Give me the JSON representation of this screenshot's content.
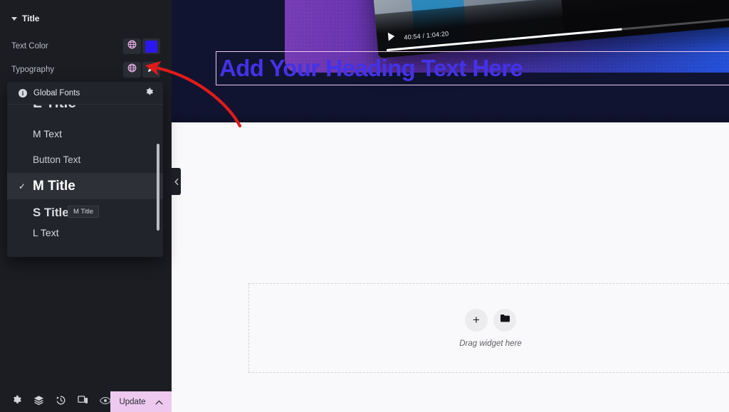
{
  "panel": {
    "section_title": "Title",
    "caret_icon": "caret-down-icon",
    "controls": [
      {
        "label": "Text Color",
        "globe_icon": "globe-icon",
        "swatch_color": "#2b18f0"
      },
      {
        "label": "Typography",
        "globe_icon": "globe-icon",
        "edit_icon": "pencil-icon"
      }
    ]
  },
  "global_fonts": {
    "header_title": "Global Fonts",
    "info_icon": "info-icon",
    "info_glyph": "i",
    "settings_icon": "gear-icon",
    "check_glyph": "✓",
    "items": [
      {
        "label": "L Title",
        "selected": false,
        "state": "clipped-top"
      },
      {
        "label": "M Text",
        "selected": false,
        "state": "full"
      },
      {
        "label": "Button Text",
        "selected": false,
        "state": "full"
      },
      {
        "label": "M Title",
        "selected": true,
        "state": "full"
      },
      {
        "label": "S Title",
        "selected": false,
        "state": "full"
      },
      {
        "label": "L Text",
        "selected": false,
        "state": "clipped-bottom"
      }
    ],
    "tooltip": "M Title"
  },
  "canvas": {
    "heading": "Add Your Heading Text Here",
    "heading_color": "#4432e8",
    "heading_outline_color": "#f0c9ee",
    "dropzone": {
      "label": "Drag widget here",
      "add_icon": "plus-icon",
      "add_glyph": "+",
      "folder_icon": "folder-icon"
    },
    "hero": {
      "video_time": "40:54 / 1:04:20",
      "play_icon": "play-icon",
      "gradient_start": "#7b3fb5",
      "gradient_end": "#1f5fe8"
    },
    "collapse_handle_icon": "chevron-left-icon"
  },
  "bottom_bar": {
    "icons": [
      {
        "name": "gear-icon",
        "title": "Settings"
      },
      {
        "name": "layers-icon",
        "title": "Navigator"
      },
      {
        "name": "history-icon",
        "title": "History"
      },
      {
        "name": "responsive-icon",
        "title": "Responsive Mode"
      },
      {
        "name": "eye-icon",
        "title": "Preview Changes"
      }
    ],
    "update_label": "Update",
    "update_chevron_icon": "chevron-up-icon",
    "update_bg": "#edc9ef"
  },
  "annotation": {
    "arrow_color": "#e01b1b"
  }
}
